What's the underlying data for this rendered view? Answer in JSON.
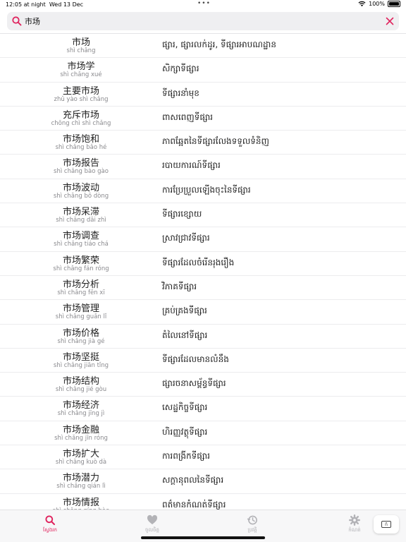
{
  "status": {
    "time": "12:05 at night",
    "date": "Wed 13 Dec",
    "battery": "100%"
  },
  "search": {
    "value": "市场"
  },
  "accent": "#e0245e",
  "entries": [
    {
      "cn": "市场",
      "py": "shì chǎng",
      "km": "ផ្សារ, ផ្សារលក់ដូរ, ទីផ្សារអាបណដ្ឋាន"
    },
    {
      "cn": "市场学",
      "py": "shì chǎng xué",
      "km": "សិក្សាទីផ្សារ"
    },
    {
      "cn": "主要市场",
      "py": "zhǔ yào shì chǎng",
      "km": "ទីផ្សារនាំមុខ"
    },
    {
      "cn": "充斥市场",
      "py": "chōng chì shì chǎng",
      "km": "ពាសពេញទីផ្សារ"
    },
    {
      "cn": "市场饱和",
      "py": "shì chǎng bǎo hé",
      "km": "ភាពឆ្អែតនៃទីផ្សារលែងទទួលទំនិញ"
    },
    {
      "cn": "市场报告",
      "py": "shì chǎng bào gào",
      "km": "របាយការណ៍ទីផ្សារ"
    },
    {
      "cn": "市场波动",
      "py": "shì chǎng bō dòng",
      "km": "ការប្រែប្រួលឡើងចុះនៃទីផ្សារ"
    },
    {
      "cn": "市场呆滞",
      "py": "shì chǎng dāi zhì",
      "km": "ទីផ្សារខ្សោយ"
    },
    {
      "cn": "市场调查",
      "py": "shì chǎng tiáo chá",
      "km": "ស្រាវជ្រាវទីផ្សារ"
    },
    {
      "cn": "市场繁荣",
      "py": "shì chǎng fán róng",
      "km": "ទីផ្សារដែលចំរើនរុងរឿង"
    },
    {
      "cn": "市场分析",
      "py": "shì chǎng fēn xī",
      "km": "វិភាគទីផ្សារ"
    },
    {
      "cn": "市场管理",
      "py": "shì chǎng guǎn lǐ",
      "km": "គ្រប់គ្រងទីផ្សារ"
    },
    {
      "cn": "市场价格",
      "py": "shì chǎng jià gé",
      "km": "តំលៃនៅទីផ្សារ"
    },
    {
      "cn": "市场坚挺",
      "py": "shì chǎng jiān tǐng",
      "km": "ទីផ្សារដែលមានលំនឹង"
    },
    {
      "cn": "市场结构",
      "py": "shì chǎng jié gòu",
      "km": "ផ្សារចនាសម្ព័ន្ធទីផ្សារ"
    },
    {
      "cn": "市场经济",
      "py": "shì chǎng jīng jì",
      "km": "សេដ្ឋកិច្ចទីផ្សារ"
    },
    {
      "cn": "市场金融",
      "py": "shì chǎng jīn róng",
      "km": "ហិរញ្ញវត្ថុទីផ្សារ"
    },
    {
      "cn": "市场扩大",
      "py": "shì chǎng kuò dà",
      "km": "ការពង្រីកទីផ្សារ"
    },
    {
      "cn": "市场潜力",
      "py": "shì chǎng qián lì",
      "km": "សក្តានុពលនៃទីផ្សារ"
    },
    {
      "cn": "市场情报",
      "py": "shì chǎng qíng bào",
      "km": "ពត៌មានកំណត់ទីផ្សារ"
    }
  ],
  "tabs": [
    {
      "label": "ស្វែងរក",
      "icon": "search-icon",
      "active": true
    },
    {
      "label": "ចូលចិត្ត",
      "icon": "heart-icon",
      "active": false
    },
    {
      "label": "ប្រវត្តិ",
      "icon": "history-icon",
      "active": false
    },
    {
      "label": "កំណត់",
      "icon": "gear-icon",
      "active": false
    }
  ],
  "keyboard_button": {
    "glyph": "ñ"
  }
}
